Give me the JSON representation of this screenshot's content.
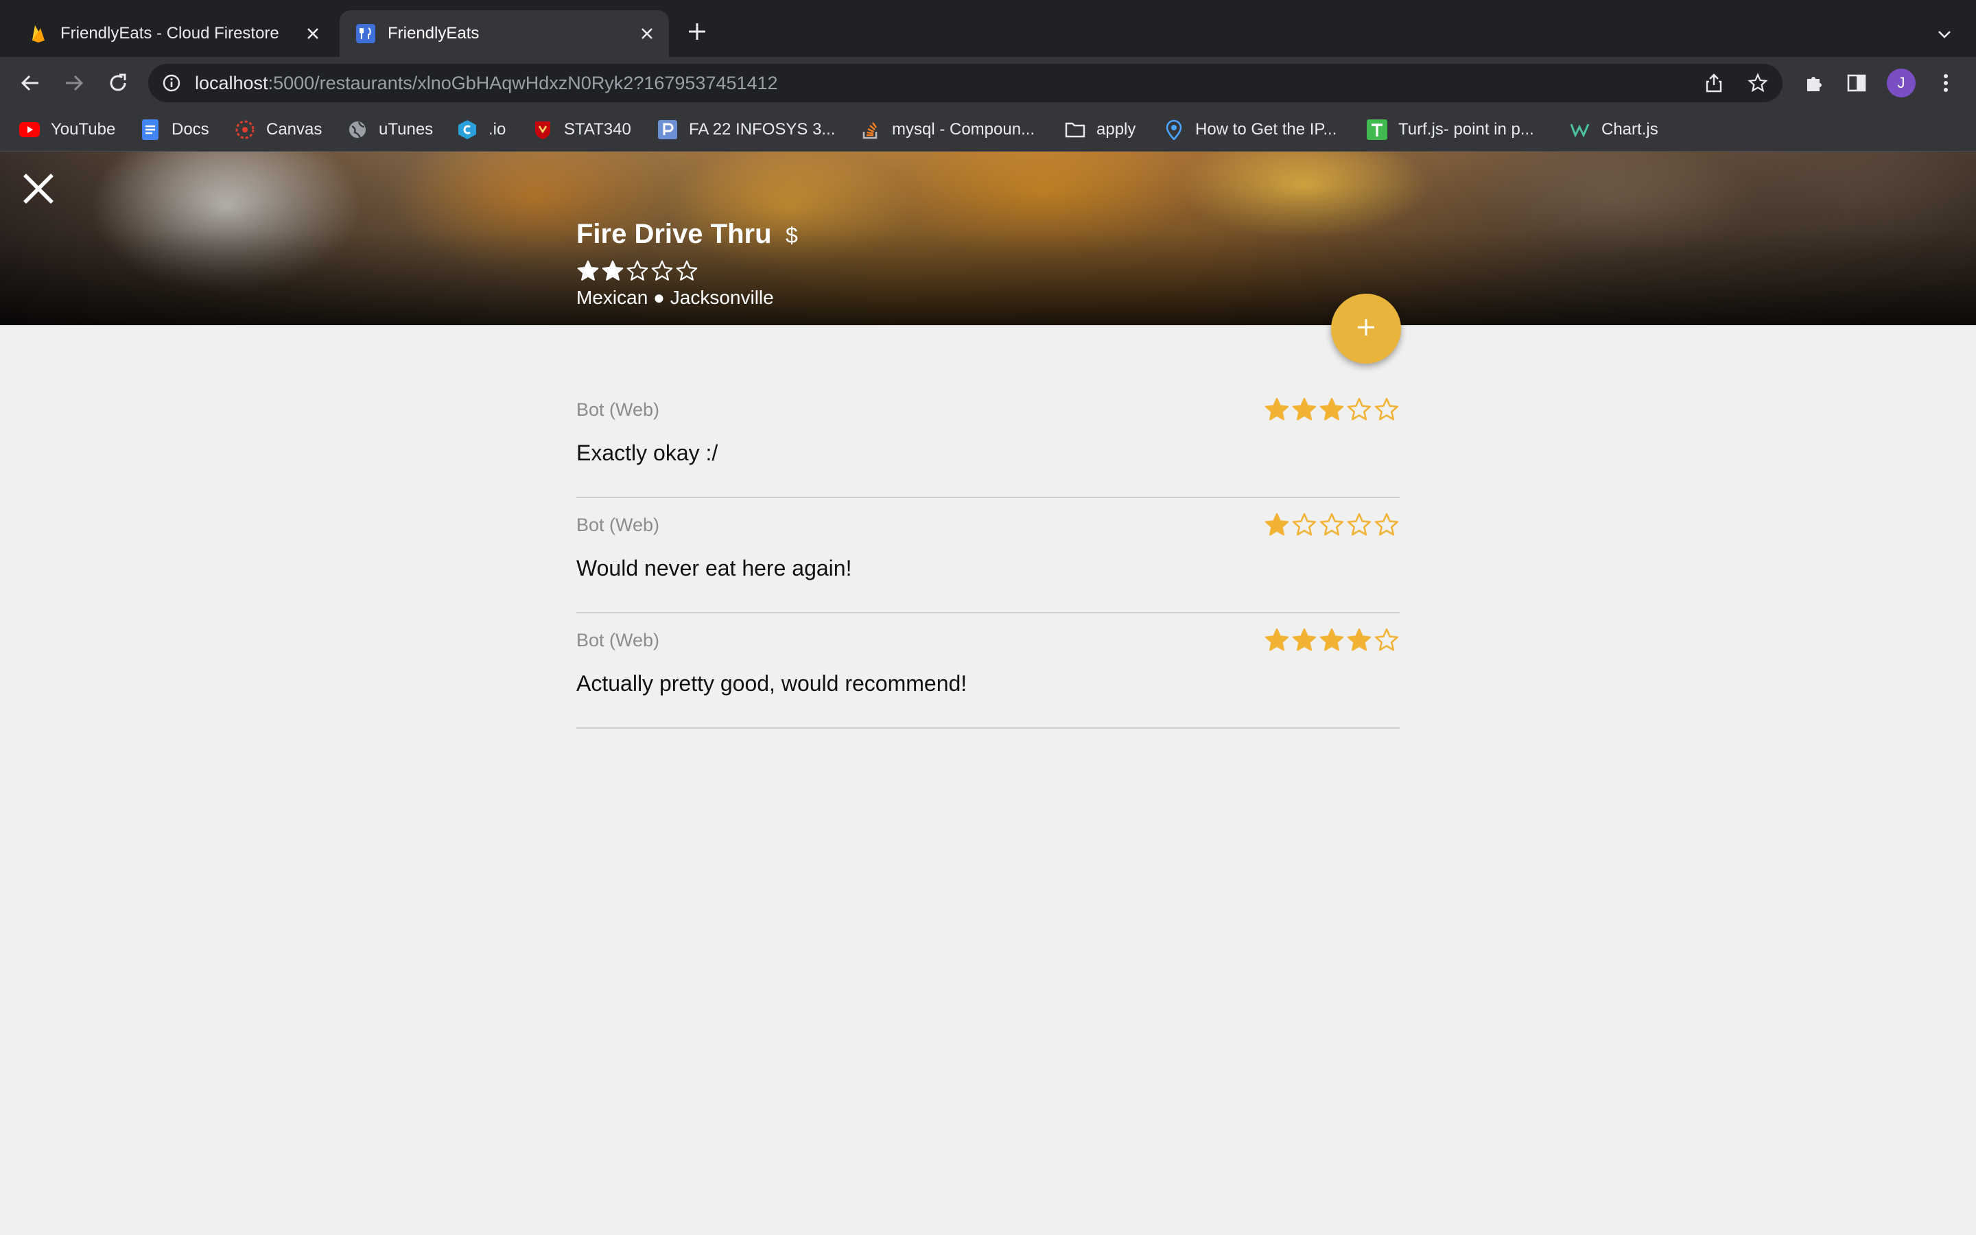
{
  "browser": {
    "tabs": [
      {
        "title": "FriendlyEats - Cloud Firestore",
        "favicon": "firebase-flame-icon",
        "active": false
      },
      {
        "title": "FriendlyEats",
        "favicon": "fork-knife-icon",
        "active": true
      }
    ],
    "url_host": "localhost",
    "url_rest": ":5000/restaurants/xlnoGbHAqwHdxzN0Ryk2?1679537451412",
    "avatar_letter": "J",
    "bookmarks": [
      {
        "label": "YouTube",
        "icon": "youtube-icon"
      },
      {
        "label": "Docs",
        "icon": "docs-icon"
      },
      {
        "label": "Canvas",
        "icon": "canvas-icon"
      },
      {
        "label": "uTunes",
        "icon": "globe-icon"
      },
      {
        "label": ".io",
        "icon": "c-logo-icon"
      },
      {
        "label": "STAT340",
        "icon": "crest-icon"
      },
      {
        "label": "FA 22 INFOSYS 3...",
        "icon": "p-logo-icon"
      },
      {
        "label": "mysql - Compoun...",
        "icon": "stackoverflow-icon"
      },
      {
        "label": "apply",
        "icon": "folder-icon"
      },
      {
        "label": "How to Get the IP...",
        "icon": "location-pin-icon"
      },
      {
        "label": "Turf.js- point in p...",
        "icon": "turf-icon"
      },
      {
        "label": "Chart.js",
        "icon": "chartjs-icon"
      }
    ]
  },
  "restaurant": {
    "name": "Fire Drive Thru",
    "price": "$",
    "rating": 2,
    "max_rating": 5,
    "category": "Mexican",
    "separator": "●",
    "city": "Jacksonville"
  },
  "reviews": [
    {
      "author": "Bot (Web)",
      "rating": 3,
      "text": "Exactly okay :/"
    },
    {
      "author": "Bot (Web)",
      "rating": 1,
      "text": "Would never eat here again!"
    },
    {
      "author": "Bot (Web)",
      "rating": 4,
      "text": "Actually pretty good, would recommend!"
    }
  ],
  "colors": {
    "star_accent": "#f2b233",
    "fab": "#e8b43b",
    "page_bg": "#f0f0f0",
    "hero_star": "#ffffff"
  },
  "fab_icon": "plus-icon"
}
